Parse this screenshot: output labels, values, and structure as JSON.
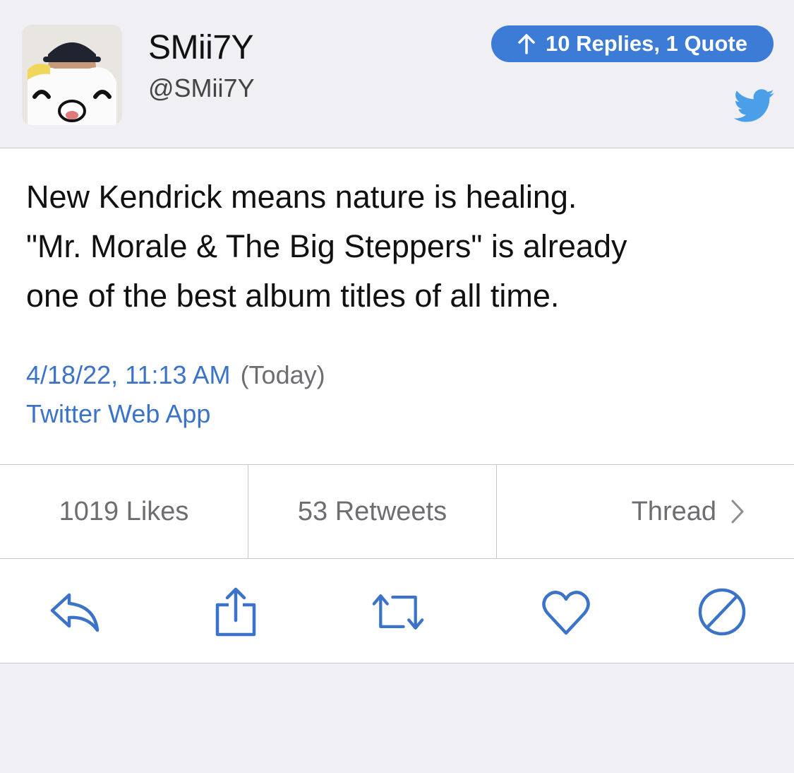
{
  "header": {
    "display_name": "SMii7Y",
    "handle": "@SMii7Y",
    "replies_pill": "10 Replies, 1 Quote"
  },
  "tweet": {
    "lines": [
      "New Kendrick means nature is healing.",
      "\"Mr. Morale & The Big Steppers\" is already",
      "one of the best album titles of all time."
    ],
    "timestamp": "4/18/22, 11:13 AM",
    "relative": "(Today)",
    "client": "Twitter Web App"
  },
  "stats": {
    "likes": "1019 Likes",
    "retweets": "53 Retweets",
    "thread": "Thread"
  },
  "icons": {
    "reply": "reply-arrow",
    "share": "share-upload",
    "retweet": "retweet-arrows",
    "like": "heart",
    "block": "prohibited-circle",
    "brand": "twitter-bird",
    "up_arrow": "arrow-up",
    "chevron": "chevron-right"
  },
  "colors": {
    "accent": "#3b73c9",
    "pill": "#3d7cd6",
    "twitter_blue": "#4a9fe8",
    "background": "#efeff4",
    "divider": "#c8c8cc"
  }
}
